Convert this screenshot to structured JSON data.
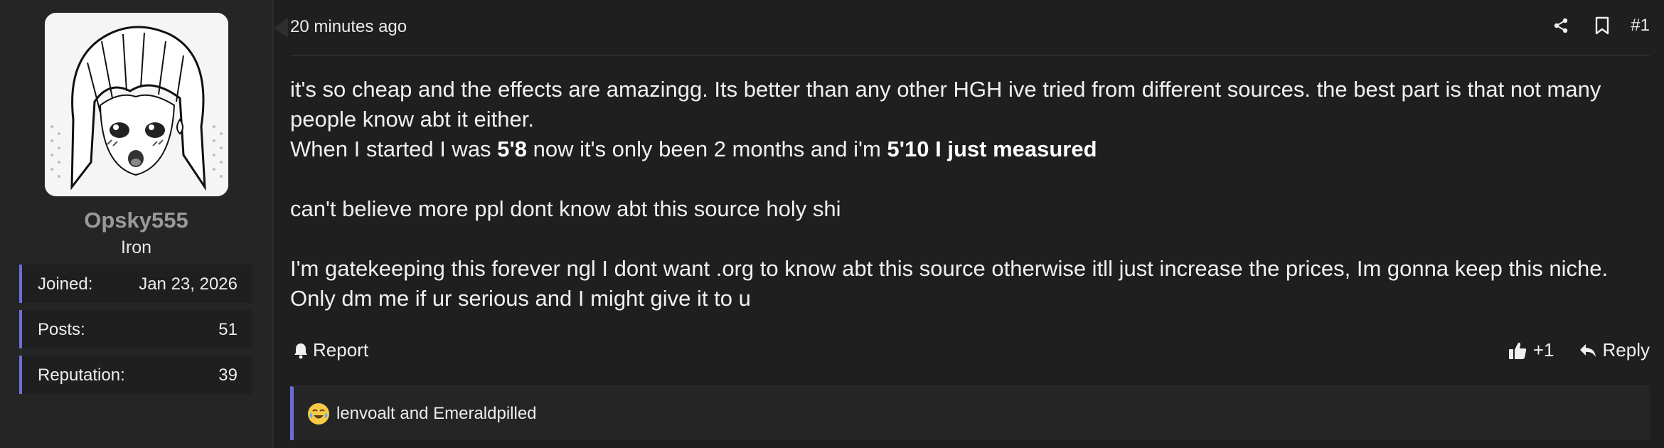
{
  "user": {
    "username": "Opsky555",
    "rank": "Iron",
    "stats": [
      {
        "label": "Joined:",
        "value": "Jan 23, 2026"
      },
      {
        "label": "Posts:",
        "value": "51"
      },
      {
        "label": "Reputation:",
        "value": "39"
      }
    ]
  },
  "post": {
    "timestamp": "20 minutes ago",
    "number": "#1",
    "icons": [
      "share-icon",
      "bookmark-icon"
    ],
    "body": {
      "line1": "it's so cheap and the effects are amazingg. Its better than any other HGH ive tried from different sources. the best part is that not many people know abt it either.",
      "line2_a": "When I started I was ",
      "line2_b": "5'8",
      "line2_c": " now it's only been 2 months and i'm ",
      "line2_d": "5'10 I just measured",
      "line3": "can't believe more ppl dont know abt this source holy shi",
      "line4": "I'm gatekeeping this forever ngl I dont want .org to know abt this source otherwise itll just increase the prices, Im gonna keep this niche. Only dm me if ur serious and I might give it to u"
    }
  },
  "actions": {
    "report_label": "Report",
    "like_label": "+1",
    "reply_label": "Reply"
  },
  "reactions": {
    "emoji": "tears-of-joy-emoji",
    "text": "lenvoalt and Emeraldpilled"
  },
  "colors": {
    "accent": "#6a6fd8",
    "background": "#1f1f1f",
    "sidebar": "#252525",
    "username": "#9a9a9a"
  }
}
